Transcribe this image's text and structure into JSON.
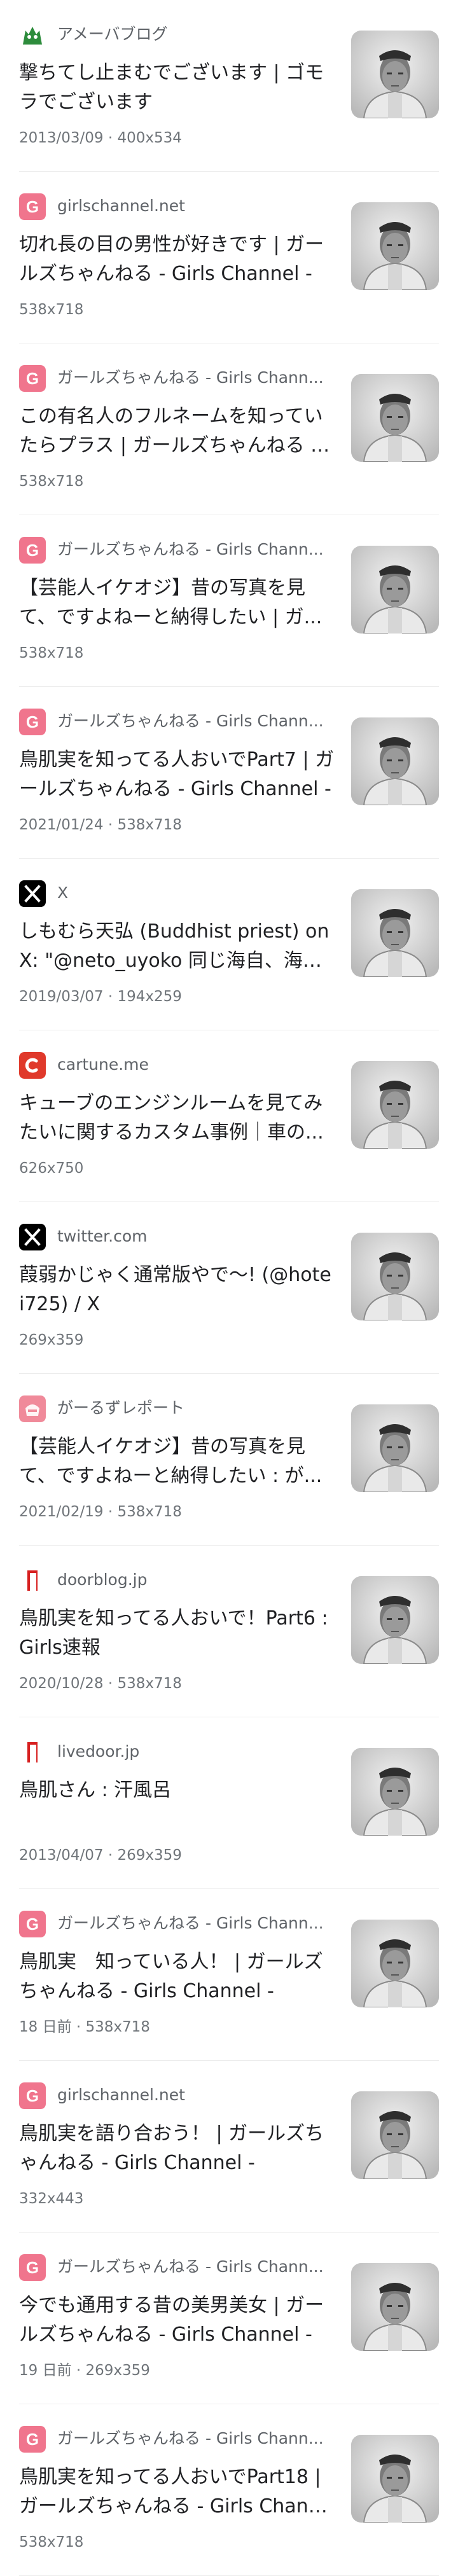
{
  "results": [
    {
      "site": "アメーバブログ",
      "title": "撃ちてし止まむでございます | ゴモラでございます",
      "meta": "2013/03/09 · 400x534",
      "favicon": "ameba-icon",
      "thumb": "portrait-image"
    },
    {
      "site": "girlschannel.net",
      "title": "切れ長の目の男性が好きです | ガールズちゃんねる - Girls Channel -",
      "meta": "538x718",
      "favicon": "girlschannel-icon",
      "thumb": "portrait-image"
    },
    {
      "site": "ガールズちゃんねる - Girls Chann...",
      "title": "この有名人のフルネームを知っていたらプラス | ガールズちゃんねる - ...",
      "meta": "538x718",
      "favicon": "girlschannel-icon",
      "thumb": "portrait-image"
    },
    {
      "site": "ガールズちゃんねる - Girls Chann...",
      "title": "【芸能人イケオジ】昔の写真を見て、ですよねーと納得したい | ガ...",
      "meta": "538x718",
      "favicon": "girlschannel-icon",
      "thumb": "portrait-image"
    },
    {
      "site": "ガールズちゃんねる - Girls Chann...",
      "title": "鳥肌実を知ってる人おいでPart7 | ガールズちゃんねる - Girls Channel -",
      "meta": "2021/01/24 · 538x718",
      "favicon": "girlschannel-icon",
      "thumb": "portrait-image"
    },
    {
      "site": "X",
      "title": "しもむら天弘 (Buddhist priest) on X: \"@neto_uyoko 同じ海自、海軍...",
      "meta": "2019/03/07 · 194x259",
      "favicon": "x-icon",
      "thumb": "portrait-image"
    },
    {
      "site": "cartune.me",
      "title": "キューブのエンジンルームを見てみたいに関するカスタム事例｜車の...",
      "meta": "626x750",
      "favicon": "cartune-icon",
      "thumb": "portrait-image"
    },
    {
      "site": "twitter.com",
      "title": "葭弱かじゃく通常版やで〜! (@hotei725) / X",
      "meta": "269x359",
      "favicon": "x-icon",
      "thumb": "portrait-image"
    },
    {
      "site": "がーるずレポート",
      "title": "【芸能人イケオジ】昔の写真を見て、ですよねーと納得したい : が...",
      "meta": "2021/02/19 · 538x718",
      "favicon": "girlsreport-icon",
      "thumb": "portrait-image"
    },
    {
      "site": "doorblog.jp",
      "title": "鳥肌実を知ってる人おいで！Part6 : Girls速報",
      "meta": "2020/10/28 · 538x718",
      "favicon": "livedoor-icon",
      "thumb": "portrait-image"
    },
    {
      "site": "livedoor.jp",
      "title": "鳥肌さん : 汗風呂",
      "meta": "2013/04/07 · 269x359",
      "favicon": "livedoor-icon",
      "thumb": "portrait-image"
    },
    {
      "site": "ガールズちゃんねる - Girls Chann...",
      "title": "鳥肌実　知っている人！ | ガールズちゃんねる - Girls Channel -",
      "meta": "18 日前 · 538x718",
      "favicon": "girlschannel-icon",
      "thumb": "portrait-image"
    },
    {
      "site": "girlschannel.net",
      "title": "鳥肌実を語り合おう！ | ガールズちゃんねる - Girls Channel -",
      "meta": "332x443",
      "favicon": "girlschannel-icon",
      "thumb": "portrait-image"
    },
    {
      "site": "ガールズちゃんねる - Girls Chann...",
      "title": "今でも通用する昔の美男美女 | ガールズちゃんねる - Girls Channel -",
      "meta": "19 日前 · 269x359",
      "favicon": "girlschannel-icon",
      "thumb": "portrait-image"
    },
    {
      "site": "ガールズちゃんねる - Girls Chann...",
      "title": "鳥肌実を知ってる人おいでPart18 | ガールズちゃんねる - Girls Chann...",
      "meta": "538x718",
      "favicon": "girlschannel-icon",
      "thumb": "portrait-image"
    }
  ],
  "colors": {
    "girlschannel": "#f0758d",
    "ameba": "#2d8c3c",
    "x": "#000000",
    "cartune": "#e0392b",
    "girlsreport": "#f08a9a",
    "livedoor": "#d71f1f"
  }
}
